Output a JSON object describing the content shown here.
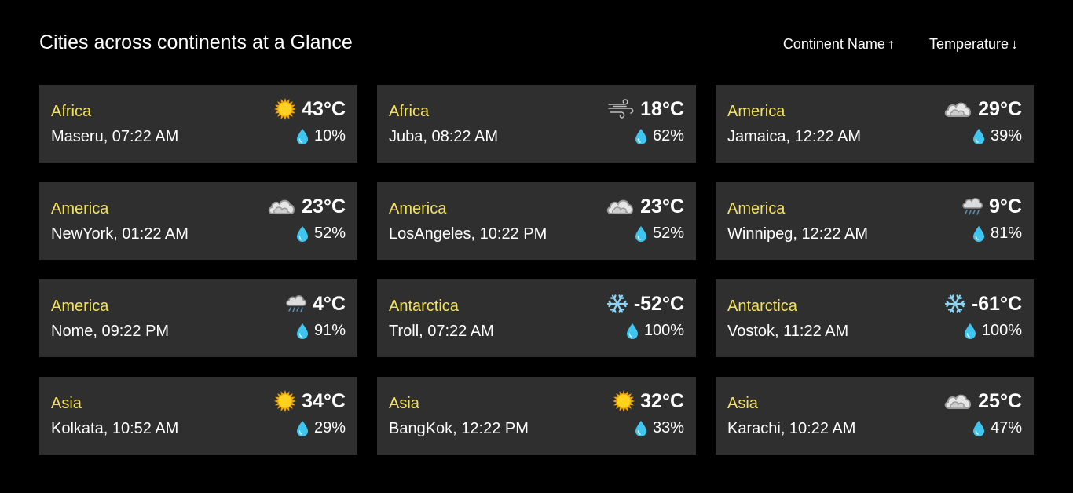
{
  "header": {
    "title": "Cities across continents at a Glance",
    "sort_continent_label": "Continent Name",
    "sort_continent_arrow": "↑",
    "sort_temperature_label": "Temperature",
    "sort_temperature_arrow": "↓"
  },
  "colors": {
    "background": "#000000",
    "card": "#2f2f2f",
    "continent_text": "#f3e15a",
    "drop": "#3fc6f0"
  },
  "cards": [
    {
      "continent": "Africa",
      "city": "Maseru, 07:22 AM",
      "temp": "43°C",
      "humidity": "10%",
      "icon": "sun-icon"
    },
    {
      "continent": "Africa",
      "city": "Juba, 08:22 AM",
      "temp": "18°C",
      "humidity": "62%",
      "icon": "wind-icon"
    },
    {
      "continent": "America",
      "city": "Jamaica, 12:22 AM",
      "temp": "29°C",
      "humidity": "39%",
      "icon": "cloud-icon"
    },
    {
      "continent": "America",
      "city": "NewYork, 01:22 AM",
      "temp": "23°C",
      "humidity": "52%",
      "icon": "cloud-icon"
    },
    {
      "continent": "America",
      "city": "LosAngeles, 10:22 PM",
      "temp": "23°C",
      "humidity": "52%",
      "icon": "cloud-icon"
    },
    {
      "continent": "America",
      "city": "Winnipeg, 12:22 AM",
      "temp": "9°C",
      "humidity": "81%",
      "icon": "rain-cloud-icon"
    },
    {
      "continent": "America",
      "city": "Nome, 09:22 PM",
      "temp": "4°C",
      "humidity": "91%",
      "icon": "rain-cloud-icon"
    },
    {
      "continent": "Antarctica",
      "city": "Troll, 07:22 AM",
      "temp": "-52°C",
      "humidity": "100%",
      "icon": "snowflake-icon"
    },
    {
      "continent": "Antarctica",
      "city": "Vostok, 11:22 AM",
      "temp": "-61°C",
      "humidity": "100%",
      "icon": "snowflake-icon"
    },
    {
      "continent": "Asia",
      "city": "Kolkata, 10:52 AM",
      "temp": "34°C",
      "humidity": "29%",
      "icon": "sun-icon"
    },
    {
      "continent": "Asia",
      "city": "BangKok, 12:22 PM",
      "temp": "32°C",
      "humidity": "33%",
      "icon": "sun-icon"
    },
    {
      "continent": "Asia",
      "city": "Karachi, 10:22 AM",
      "temp": "25°C",
      "humidity": "47%",
      "icon": "cloud-icon"
    }
  ]
}
